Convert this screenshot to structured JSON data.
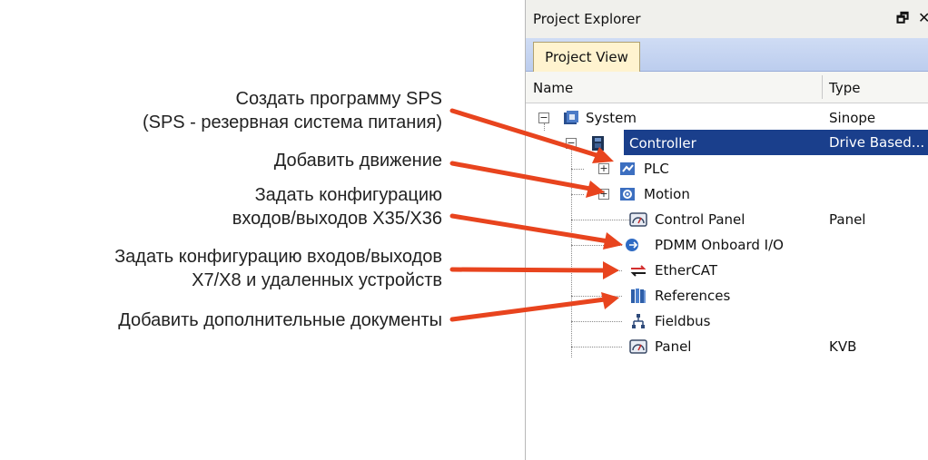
{
  "annotations": [
    {
      "line1": "Создать программу SPS",
      "line2": "(SPS - резервная система питания)"
    },
    {
      "line1": "Добавить движение"
    },
    {
      "line1": "Задать конфигурацию",
      "line2": "входов/выходов X35/X36"
    },
    {
      "line1": "Задать конфигурацию входов/выходов",
      "line2": "X7/X8 и удаленных устройств"
    },
    {
      "line1": "Добавить дополнительные документы"
    }
  ],
  "arrow_color": "#e8441e",
  "panel": {
    "title": "Project Explorer",
    "pin_glyph": "🗗",
    "close_glyph": "✕",
    "tab_label": "Project View",
    "col_name": "Name",
    "col_type": "Type"
  },
  "tree": [
    {
      "label": "System",
      "type": "Sinope",
      "icon": "system-icon",
      "expander": "−"
    },
    {
      "label": "Controller",
      "type": "Drive Based...",
      "icon": "controller-icon",
      "expander": "−",
      "selected": true
    },
    {
      "label": "PLC",
      "type": "",
      "icon": "plc-icon",
      "expander": "+"
    },
    {
      "label": "Motion",
      "type": "",
      "icon": "motion-icon",
      "expander": "+"
    },
    {
      "label": "Control Panel",
      "type": "Panel",
      "icon": "gauge-icon"
    },
    {
      "label": "PDMM Onboard I/O",
      "type": "",
      "icon": "io-icon"
    },
    {
      "label": "EtherCAT",
      "type": "",
      "icon": "ethercat-icon"
    },
    {
      "label": "References",
      "type": "",
      "icon": "references-icon"
    },
    {
      "label": "Fieldbus",
      "type": "",
      "icon": "fieldbus-icon"
    },
    {
      "label": "Panel",
      "type": "KVB",
      "icon": "gauge-icon"
    }
  ]
}
